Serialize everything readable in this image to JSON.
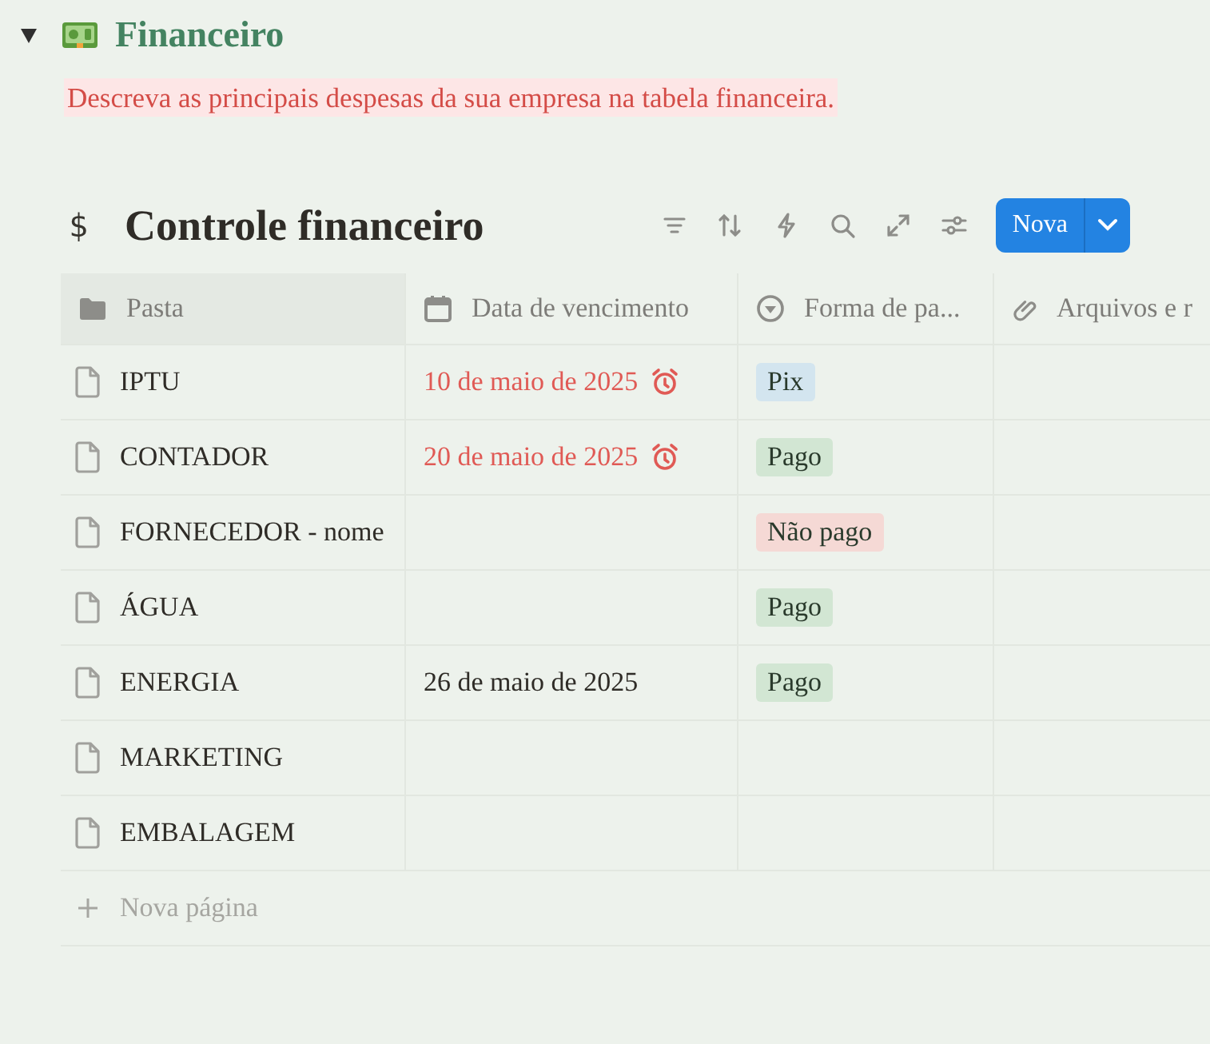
{
  "section": {
    "expanded": true,
    "title": "Financeiro",
    "description": "Descreva as principais despesas da sua empresa na tabela financeira."
  },
  "database": {
    "icon": "$",
    "title": "Controle financeiro",
    "new_button": "Nova",
    "columns": [
      {
        "label": "Pasta",
        "kind": "folder"
      },
      {
        "label": "Data de vencimento",
        "kind": "date"
      },
      {
        "label": "Forma de pa...",
        "kind": "select"
      },
      {
        "label": "Arquivos e r",
        "kind": "files"
      }
    ],
    "rows": [
      {
        "name": "IPTU",
        "due_date": "10 de maio de 2025",
        "overdue": true,
        "payment": {
          "label": "Pix",
          "color": "#d3e5ef"
        }
      },
      {
        "name": "CONTADOR",
        "due_date": "20 de maio de 2025",
        "overdue": true,
        "payment": {
          "label": "Pago",
          "color": "#d2e6d3"
        }
      },
      {
        "name": "FORNECEDOR - nome",
        "payment": {
          "label": "Não pago",
          "color": "#f5d9d5"
        }
      },
      {
        "name": "ÁGUA",
        "payment": {
          "label": "Pago",
          "color": "#d2e6d3"
        }
      },
      {
        "name": "ENERGIA",
        "due_date": "26 de maio de 2025",
        "overdue": false,
        "payment": {
          "label": "Pago",
          "color": "#d2e6d3"
        }
      },
      {
        "name": "MARKETING"
      },
      {
        "name": "EMBALAGEM"
      }
    ],
    "add_row": "Nova página"
  }
}
